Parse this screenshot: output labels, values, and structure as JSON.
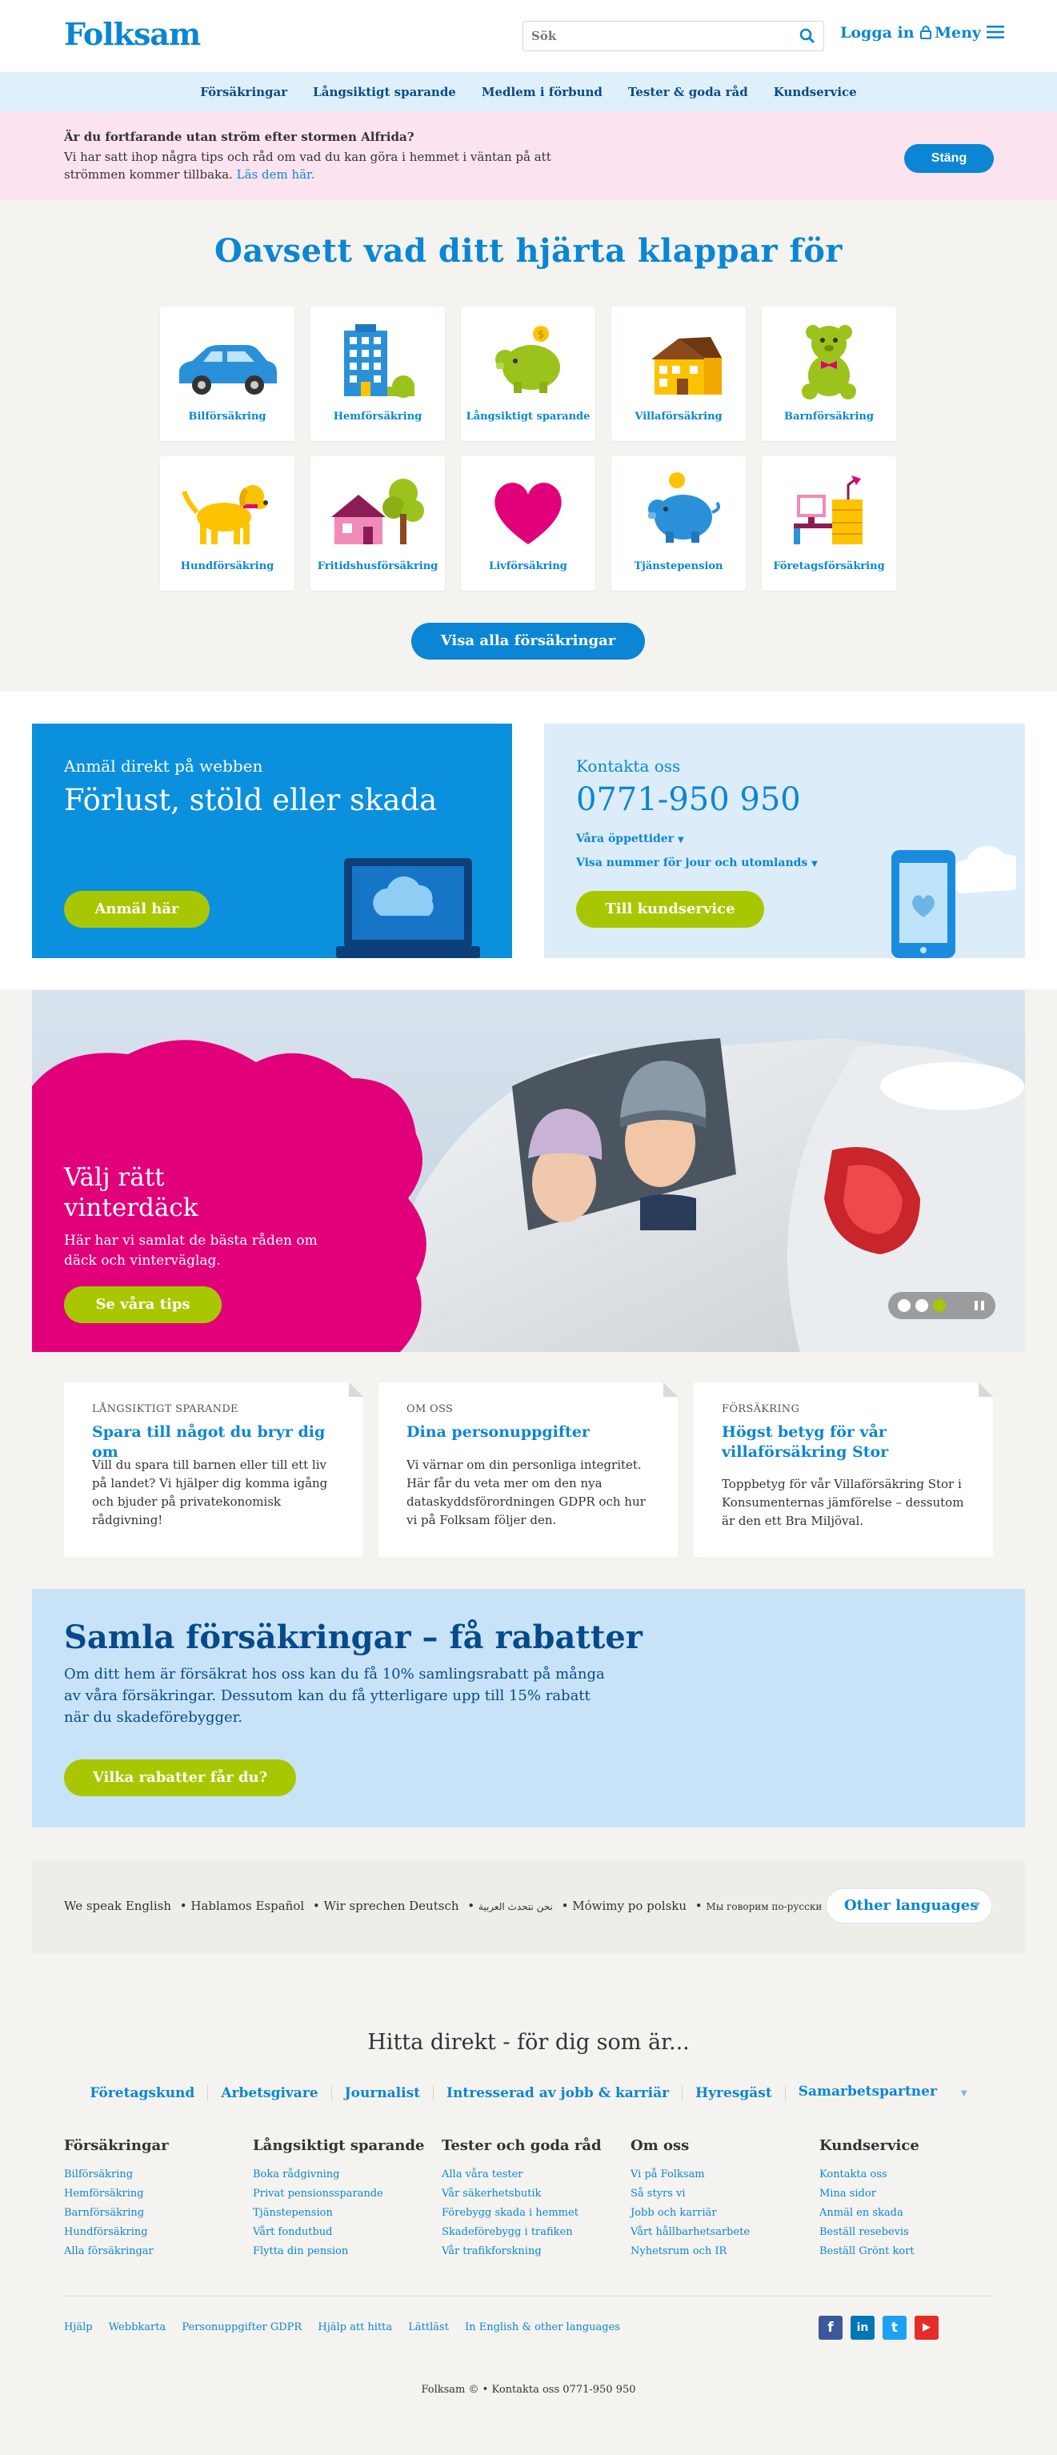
{
  "header": {
    "logo": "Folksam",
    "search_placeholder": "Sök",
    "login_label": "Logga in",
    "menu_label": "Meny"
  },
  "subnav": [
    "Försäkringar",
    "Långsiktigt sparande",
    "Medlem i förbund",
    "Tester & goda råd",
    "Kundservice"
  ],
  "alert": {
    "title": "Är du fortfarande utan ström efter stormen Alfrida?",
    "text": "Vi har satt ihop några tips och råd om vad du kan göra i hemmet i väntan på att strömmen kommer tillbaka.",
    "link": "Läs dem här.",
    "close_label": "Stäng"
  },
  "hero": {
    "title": "Oavsett vad ditt hjärta klappar för",
    "tiles": [
      {
        "label": "Bilförsäkring",
        "icon": "car-icon"
      },
      {
        "label": "Hemförsäkring",
        "icon": "apartment-building-icon"
      },
      {
        "label": "Långsiktigt sparande",
        "icon": "piggy-bank-icon"
      },
      {
        "label": "Villaförsäkring",
        "icon": "house-icon"
      },
      {
        "label": "Barnförsäkring",
        "icon": "teddy-bear-icon"
      },
      {
        "label": "Hundförsäkring",
        "icon": "dog-icon"
      },
      {
        "label": "Fritidshusförsäkring",
        "icon": "cottage-icon"
      },
      {
        "label": "Livförsäkring",
        "icon": "heart-icon"
      },
      {
        "label": "Tjänstepension",
        "icon": "piggy-bank-coin-icon"
      },
      {
        "label": "Företagsförsäkring",
        "icon": "office-desk-icon"
      }
    ],
    "all_button": "Visa alla försäkringar"
  },
  "report": {
    "subtitle": "Anmäl direkt på webben",
    "title": "Förlust, stöld eller skada",
    "button": "Anmäl här"
  },
  "contact": {
    "subtitle": "Kontakta oss",
    "phone": "0771-950 950",
    "hours_link": "Våra öppettider",
    "jour_link": "Visa nummer för jour och utomlands",
    "button": "Till kundservice"
  },
  "promo": {
    "title": "Välj rätt vinterdäck",
    "text": "Här har vi samlat de bästa råden om däck och vinterväglag.",
    "button": "Se våra tips",
    "slides_total": 3,
    "active_slide": 3
  },
  "articles": [
    {
      "category": "LÅNGSIKTIGT SPARANDE",
      "title": "Spara till något du bryr dig om",
      "text": "Vill du spara till barnen eller till ett liv på landet? Vi hjälper dig komma igång och bjuder på privatekonomisk rådgivning!"
    },
    {
      "category": "OM OSS",
      "title": "Dina personuppgifter",
      "text": "Vi värnar om din personliga integritet. Här får du veta mer om den nya dataskyddsförordningen GDPR och hur vi på Folksam följer den."
    },
    {
      "category": "FÖRSÄKRING",
      "title": "Högst betyg för vår villaförsäkring Stor",
      "text": "Toppbetyg för vår Villaförsäkring Stor i Konsumenternas jämförelse – dessutom är den ett Bra Miljöval."
    }
  ],
  "samla": {
    "title": "Samla försäkringar – få rabatter",
    "text": "Om ditt hem är försäkrat hos oss kan du få 10% samlingsrabatt på många av våra försäkringar. Dessutom kan du få ytterligare upp till 15% rabatt när du skadeförebygger.",
    "button": "Vilka rabatter får du?"
  },
  "languages": {
    "items": [
      "We speak English",
      "Hablamos Español",
      "Wir sprechen Deutsch",
      "نحن نتحدث العربية",
      "Mówimy po polsku",
      "Мы говорим по-русски"
    ],
    "other_button": "Other languages"
  },
  "footer": {
    "title": "Hitta direkt - för dig som är...",
    "audiences": [
      "Företagskund",
      "Arbetsgivare",
      "Journalist",
      "Intresserad av jobb & karriär",
      "Hyresgäst",
      "Samarbetspartner"
    ],
    "columns": [
      {
        "heading": "Försäkringar",
        "links": [
          "Bilförsäkring",
          "Hemförsäkring",
          "Barnförsäkring",
          "Hundförsäkring",
          "Alla försäkringar"
        ]
      },
      {
        "heading": "Långsiktigt sparande",
        "links": [
          "Boka rådgivning",
          "Privat pensionssparande",
          "Tjänstepension",
          "Vårt fondutbud",
          "Flytta din pension"
        ]
      },
      {
        "heading": "Tester och goda råd",
        "links": [
          "Alla våra tester",
          "Vår säkerhetsbutik",
          "Förebygg skada i hemmet",
          "Skadeförebygg i trafiken",
          "Vår trafikforskning"
        ]
      },
      {
        "heading": "Om oss",
        "links": [
          "Vi på Folksam",
          "Så styrs vi",
          "Jobb och karriär",
          "Vårt hållbarhetsarbete",
          "Nyhetsrum och IR"
        ]
      },
      {
        "heading": "Kundservice",
        "links": [
          "Kontakta oss",
          "Mina sidor",
          "Anmäl en skada",
          "Beställ resebevis",
          "Beställ Grönt kort"
        ]
      }
    ],
    "bottom_links": [
      "Hjälp",
      "Webbkarta",
      "Personuppgifter GDPR",
      "Hjälp att hitta",
      "Lättläst",
      "In English & other languages"
    ],
    "social": [
      {
        "name": "facebook-icon",
        "glyph": "f",
        "color": "#3b5998"
      },
      {
        "name": "linkedin-icon",
        "glyph": "in",
        "color": "#0077b5"
      },
      {
        "name": "twitter-icon",
        "glyph": "t",
        "color": "#1da1f2"
      },
      {
        "name": "youtube-icon",
        "glyph": "▶",
        "color": "#e52d27"
      }
    ],
    "copyright": "Folksam © •  Kontakta oss  0771-950 950"
  },
  "colors": {
    "primary": "#0a86d4",
    "navy": "#064a8a",
    "lime": "#a9c700",
    "magenta": "#e2007a"
  }
}
